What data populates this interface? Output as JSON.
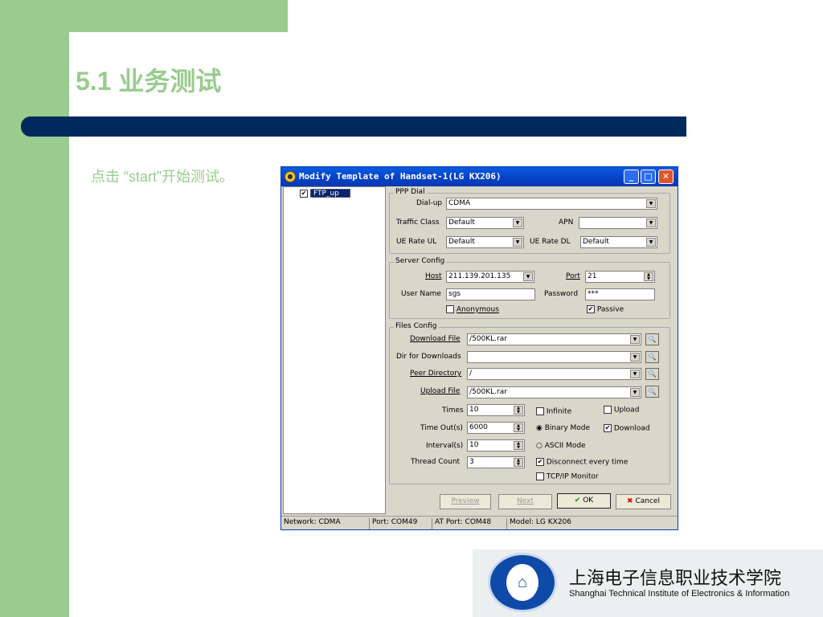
{
  "slide": {
    "title": "5.1 业务测试",
    "instruction": "点击 “start”开始测试。"
  },
  "dialog": {
    "title": "Modify Template of Handset-1(LG KX206)",
    "controls": {
      "minimize": "_",
      "maximize": "□",
      "close": "✕"
    },
    "tree": {
      "item_label": "FTP_up",
      "item_checked": true
    },
    "ppp_dial": {
      "group_label": "PPP Dial",
      "dialup_label": "Dial-up",
      "dialup_value": "CDMA",
      "traffic_class_label": "Traffic Class",
      "traffic_class_value": "Default",
      "apn_label": "APN",
      "apn_value": "",
      "ue_rate_ul_label": "UE Rate UL",
      "ue_rate_ul_value": "Default",
      "ue_rate_dl_label": "UE Rate DL",
      "ue_rate_dl_value": "Default"
    },
    "server_config": {
      "group_label": "Server Config",
      "host_label": "Host",
      "host_value": "211.139.201.135",
      "port_label": "Port",
      "port_value": "21",
      "username_label": "User Name",
      "username_value": "sgs",
      "password_label": "Password",
      "password_value": "***",
      "anonymous_label": "Anonymous",
      "anonymous_checked": false,
      "passive_label": "Passive",
      "passive_checked": true
    },
    "files_config": {
      "group_label": "Files Config",
      "download_file_label": "Download File",
      "download_file_value": "/500KL.rar",
      "dir_downloads_label": "Dir for Downloads",
      "dir_downloads_value": "",
      "peer_directory_label": "Peer Directory",
      "peer_directory_value": "/",
      "upload_file_label": "Upload File",
      "upload_file_value": "/500KL.rar",
      "times_label": "Times",
      "times_value": "10",
      "timeout_label": "Time Out(s)",
      "timeout_value": "6000",
      "interval_label": "Interval(s)",
      "interval_value": "10",
      "thread_count_label": "Thread Count",
      "thread_count_value": "3",
      "infinite_label": "Infinite",
      "infinite_checked": false,
      "upload_label": "Upload",
      "upload_checked": false,
      "binary_mode_label": "Binary Mode",
      "binary_mode_selected": true,
      "download_label": "Download",
      "download_checked": true,
      "ascii_mode_label": "ASCII Mode",
      "ascii_mode_selected": false,
      "disconnect_label": "Disconnect every time",
      "disconnect_checked": true,
      "tcpip_monitor_label": "TCP/IP Monitor",
      "tcpip_monitor_checked": false
    },
    "buttons": {
      "preview": "Preview",
      "next": "Next",
      "ok": "OK",
      "cancel": "Cancel"
    },
    "status": {
      "network": "Network: CDMA",
      "port": "Port: COM49",
      "at_port": "AT Port: COM48",
      "model": "Model: LG KX206"
    }
  },
  "logo": {
    "name_cn": "上海电子信息职业技术学院",
    "name_en": "Shanghai Technical Institute of Electronics & Information"
  },
  "colors": {
    "accent_green": "#99cc8e",
    "navy_bar": "#002a5c",
    "dialog_title_blue": "#0841c6"
  }
}
